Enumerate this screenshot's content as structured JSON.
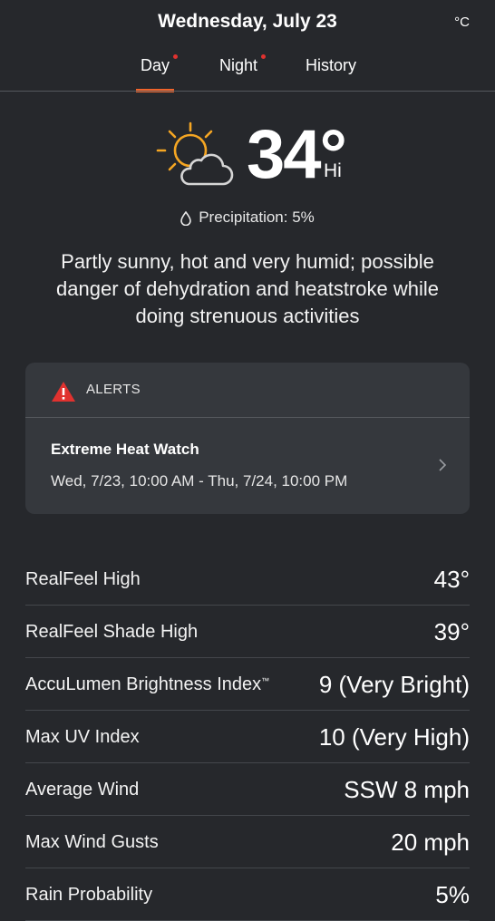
{
  "header": {
    "date": "Wednesday, July 23",
    "unit": "°C",
    "tabs": [
      {
        "label": "Day",
        "dot": true,
        "active": true
      },
      {
        "label": "Night",
        "dot": true,
        "active": false
      },
      {
        "label": "History",
        "dot": false,
        "active": false
      }
    ]
  },
  "hero": {
    "icon": "partly-sunny-icon",
    "temperature": "34°",
    "hi_label": "Hi"
  },
  "precipitation": "Precipitation: 5%",
  "description": "Partly sunny, hot and very humid; possible danger of dehydration and heatstroke while doing strenuous activities",
  "alerts": {
    "label": "ALERTS",
    "items": [
      {
        "title": "Extreme Heat Watch",
        "time": "Wed, 7/23, 10:00 AM - Thu, 7/24, 10:00 PM"
      }
    ]
  },
  "details": [
    {
      "label": "RealFeel High",
      "value": "43°"
    },
    {
      "label": "RealFeel Shade High",
      "value": "39°"
    },
    {
      "label": "AccuLumen Brightness Index",
      "trademark": "™",
      "value": "9 (Very Bright)"
    },
    {
      "label": "Max UV Index",
      "value": "10 (Very High)"
    },
    {
      "label": "Average Wind",
      "value": "SSW 8 mph"
    },
    {
      "label": "Max Wind Gusts",
      "value": "20 mph"
    },
    {
      "label": "Rain Probability",
      "value": "5%"
    }
  ],
  "colors": {
    "background": "#26282c",
    "card": "#35383d",
    "accent": "#f0642b",
    "alert_red": "#e0322f",
    "sun": "#f5a623"
  }
}
